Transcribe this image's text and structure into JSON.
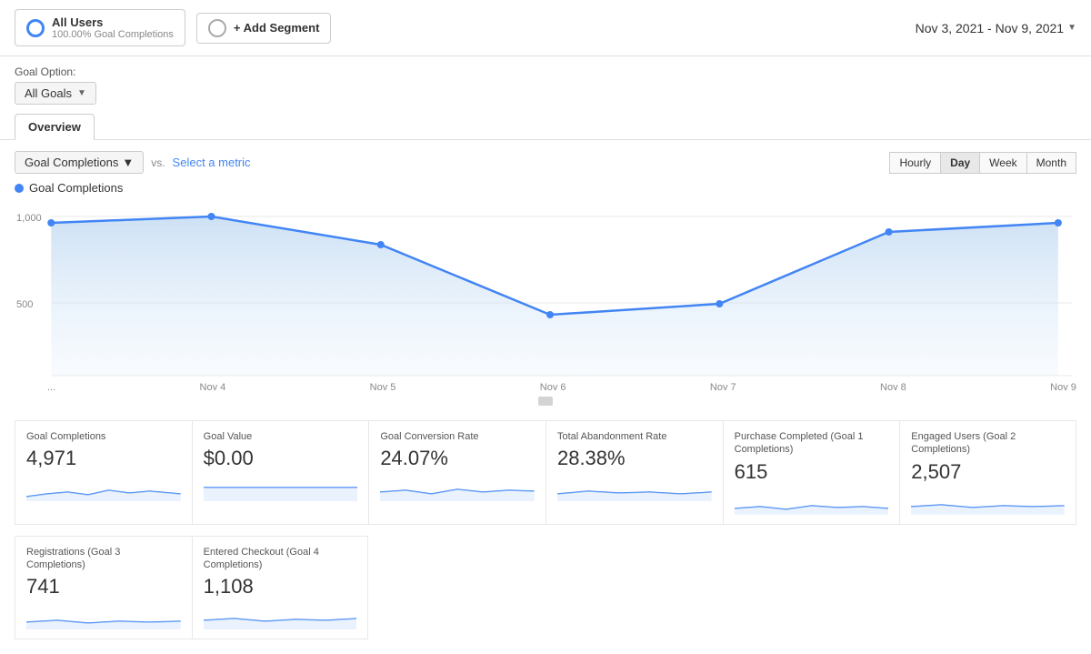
{
  "header": {
    "segment1": {
      "label": "All Users",
      "sub": "100.00% Goal Completions"
    },
    "segment2": {
      "label": "+ Add Segment"
    },
    "dateRange": "Nov 3, 2021 - Nov 9, 2021"
  },
  "goalOption": {
    "label": "Goal Option:",
    "value": "All Goals"
  },
  "tabs": [
    {
      "label": "Overview",
      "active": true
    }
  ],
  "chartControls": {
    "metric": "Goal Completions",
    "vs": "vs.",
    "selectMetric": "Select a metric",
    "timeButtons": [
      "Hourly",
      "Day",
      "Week",
      "Month"
    ],
    "activeTime": "Day"
  },
  "chartLegend": {
    "label": "Goal Completions"
  },
  "xAxisLabels": [
    "...",
    "Nov 4",
    "Nov 5",
    "Nov 6",
    "Nov 7",
    "Nov 8",
    "Nov 9"
  ],
  "yAxisLabels": [
    "1,000",
    "500"
  ],
  "stats": [
    {
      "label": "Goal Completions",
      "value": "4,971"
    },
    {
      "label": "Goal Value",
      "value": "$0.00"
    },
    {
      "label": "Goal Conversion Rate",
      "value": "24.07%"
    },
    {
      "label": "Total Abandonment Rate",
      "value": "28.38%"
    },
    {
      "label": "Purchase Completed (Goal 1 Completions)",
      "value": "615"
    },
    {
      "label": "Engaged Users (Goal 2 Completions)",
      "value": "2,507"
    }
  ],
  "stats2": [
    {
      "label": "Registrations (Goal 3 Completions)",
      "value": "741"
    },
    {
      "label": "Entered Checkout (Goal 4 Completions)",
      "value": "1,108"
    }
  ]
}
